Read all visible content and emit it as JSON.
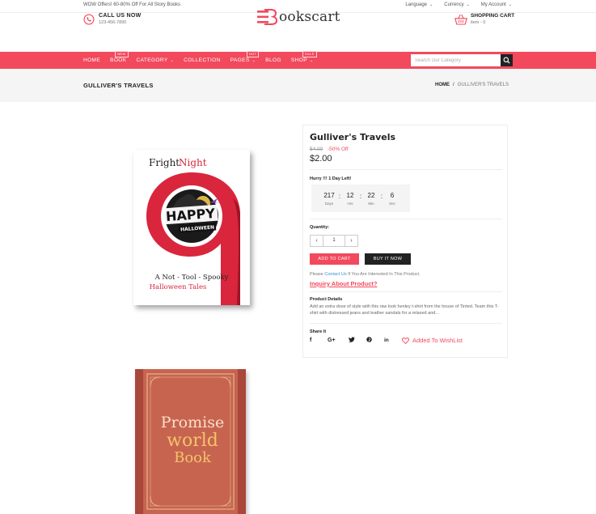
{
  "topbar": {
    "promo": "WOW Offers! 60-80% Off For All Story Books",
    "language": "Language",
    "currency": "Currency",
    "account": "My Account"
  },
  "header": {
    "call_title": "CALL US NOW",
    "call_number": "123-456-7890",
    "logo_text": "ookscart",
    "cart_title": "SHOPPING CART",
    "cart_items": "item - 0"
  },
  "nav": {
    "items": [
      {
        "label": "HOME"
      },
      {
        "label": "BOOK",
        "tag": "NEW"
      },
      {
        "label": "CATEGORY"
      },
      {
        "label": "COLLECTION"
      },
      {
        "label": "PAGES",
        "tag": "HOT"
      },
      {
        "label": "BLOG"
      },
      {
        "label": "SHOP",
        "tag": "SALE"
      }
    ],
    "search_placeholder": "Search Our Category"
  },
  "band": {
    "page_title": "GULLIVER'S TRAVELS",
    "crumb_home": "HOME",
    "crumb_sep": "/",
    "crumb_current": "GULLIVER'S TRAVELS"
  },
  "cover1": {
    "title_a": "Fright",
    "title_b": "Night",
    "happy": "HAPPY",
    "halloween": "HALLOWEEN",
    "line1": "A Not - Tool - Spooky",
    "line2": "Halloween Tales"
  },
  "cover2": {
    "line1": "Promise",
    "line2": "world",
    "line3": "Book"
  },
  "product": {
    "title": "Gulliver's Travels",
    "old_price": "$4.00",
    "discount": "-50% Off",
    "price": "$2.00",
    "hurry": "Hurry !!! 1 Day Left!",
    "timer": [
      {
        "num": "217",
        "label": "Days"
      },
      {
        "num": "12",
        "label": "Hrs"
      },
      {
        "num": "22",
        "label": "Min"
      },
      {
        "num": "6",
        "label": "Sec"
      }
    ],
    "quantity_label": "Quantity:",
    "quantity_value": "1",
    "add_to_cart": "ADD TO CART",
    "buy_now": "BUY IT NOW",
    "please_pre": "Please ",
    "please_link": "Contact Us",
    "please_post": " If You Are Interested In This Product.",
    "inquiry": "Inquiry About Product?",
    "details_label": "Product Details",
    "details_text": "Add an extra dose of style with this raw look henley t-shirt from the house of Tinted. Team this T-shirt with distressed jeans and leather sandals for a relaxed and...",
    "share_label": "Share It",
    "wishlist": "Added To WishList"
  },
  "colors": {
    "accent": "#f2495d",
    "dark": "#222222"
  }
}
